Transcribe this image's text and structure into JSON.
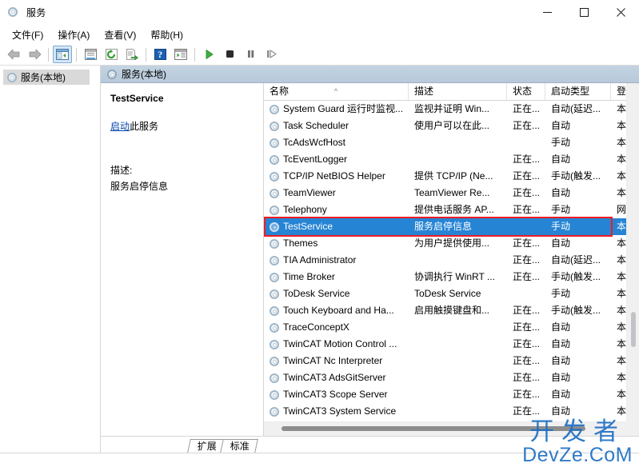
{
  "window": {
    "title": "服务",
    "icon": "services-gear-icon",
    "minimize_label": "—",
    "maximize_label": "□",
    "close_label": "✕"
  },
  "menubar": {
    "items": [
      {
        "label": "文件(F)",
        "name": "menu-file"
      },
      {
        "label": "操作(A)",
        "name": "menu-action"
      },
      {
        "label": "查看(V)",
        "name": "menu-view"
      },
      {
        "label": "帮助(H)",
        "name": "menu-help"
      }
    ]
  },
  "toolbar": {
    "buttons": [
      {
        "name": "back-button",
        "icon": "back-arrow-icon"
      },
      {
        "name": "forward-button",
        "icon": "forward-arrow-icon"
      },
      {
        "name": "show-hide-console-tree-button",
        "icon": "console-tree-icon",
        "active": true
      },
      {
        "name": "properties-button",
        "icon": "properties-window-icon"
      },
      {
        "name": "refresh-button",
        "icon": "refresh-icon"
      },
      {
        "name": "export-list-button",
        "icon": "export-list-icon"
      },
      {
        "name": "help-button",
        "icon": "help-question-icon"
      },
      {
        "name": "show-action-pane-button",
        "icon": "action-pane-icon"
      },
      {
        "name": "start-service-button",
        "icon": "play-icon"
      },
      {
        "name": "stop-service-button",
        "icon": "stop-square-icon"
      },
      {
        "name": "pause-service-button",
        "icon": "pause-bars-icon"
      },
      {
        "name": "restart-service-button",
        "icon": "restart-icon"
      }
    ]
  },
  "tree": {
    "root": {
      "label": "服务(本地)",
      "icon": "services-gear-icon",
      "selected": true
    }
  },
  "pane": {
    "header_title": "服务(本地)",
    "header_icon": "services-gear-icon"
  },
  "details": {
    "service_name": "TestService",
    "action_link": "启动",
    "action_suffix": "此服务",
    "description_label": "描述:",
    "description_text": "服务启停信息"
  },
  "list": {
    "columns": [
      {
        "label": "名称",
        "name": "column-name",
        "sort": "asc",
        "sort_glyph": "^"
      },
      {
        "label": "描述",
        "name": "column-description"
      },
      {
        "label": "状态",
        "name": "column-status"
      },
      {
        "label": "启动类型",
        "name": "column-startup-type"
      },
      {
        "label": "登录",
        "name": "column-log-on-as"
      }
    ],
    "rows": [
      {
        "name": "System Guard 运行时监视...",
        "description": "监视并证明 Win...",
        "status": "正在...",
        "startup": "自动(延迟...",
        "logon": "本地",
        "selected": false
      },
      {
        "name": "Task Scheduler",
        "description": "使用户可以在此...",
        "status": "正在...",
        "startup": "自动",
        "logon": "本地",
        "selected": false
      },
      {
        "name": "TcAdsWcfHost",
        "description": "",
        "status": "",
        "startup": "手动",
        "logon": "本地",
        "selected": false
      },
      {
        "name": "TcEventLogger",
        "description": "",
        "status": "正在...",
        "startup": "自动",
        "logon": "本地",
        "selected": false
      },
      {
        "name": "TCP/IP NetBIOS Helper",
        "description": "提供 TCP/IP (Ne...",
        "status": "正在...",
        "startup": "手动(触发...",
        "logon": "本地",
        "selected": false
      },
      {
        "name": "TeamViewer",
        "description": "TeamViewer Re...",
        "status": "正在...",
        "startup": "自动",
        "logon": "本地",
        "selected": false
      },
      {
        "name": "Telephony",
        "description": "提供电话服务 AP...",
        "status": "正在...",
        "startup": "手动",
        "logon": "网络",
        "selected": false
      },
      {
        "name": "TestService",
        "description": "服务启停信息",
        "status": "",
        "startup": "手动",
        "logon": "本地",
        "selected": true
      },
      {
        "name": "Themes",
        "description": "为用户提供使用...",
        "status": "正在...",
        "startup": "自动",
        "logon": "本地",
        "selected": false
      },
      {
        "name": "TIA Administrator",
        "description": "",
        "status": "正在...",
        "startup": "自动(延迟...",
        "logon": "本地",
        "selected": false
      },
      {
        "name": "Time Broker",
        "description": "协调执行 WinRT ...",
        "status": "正在...",
        "startup": "手动(触发...",
        "logon": "本地",
        "selected": false
      },
      {
        "name": "ToDesk Service",
        "description": "ToDesk Service",
        "status": "",
        "startup": "手动",
        "logon": "本地",
        "selected": false
      },
      {
        "name": "Touch Keyboard and Ha...",
        "description": "启用触摸键盘和...",
        "status": "正在...",
        "startup": "手动(触发...",
        "logon": "本地",
        "selected": false
      },
      {
        "name": "TraceConceptX",
        "description": "",
        "status": "正在...",
        "startup": "自动",
        "logon": "本地",
        "selected": false
      },
      {
        "name": "TwinCAT Motion Control ...",
        "description": "",
        "status": "正在...",
        "startup": "自动",
        "logon": "本地",
        "selected": false
      },
      {
        "name": "TwinCAT Nc Interpreter",
        "description": "",
        "status": "正在...",
        "startup": "自动",
        "logon": "本地",
        "selected": false
      },
      {
        "name": "TwinCAT3 AdsGitServer",
        "description": "",
        "status": "正在...",
        "startup": "自动",
        "logon": "本地",
        "selected": false
      },
      {
        "name": "TwinCAT3 Scope Server",
        "description": "",
        "status": "正在...",
        "startup": "自动",
        "logon": "本地",
        "selected": false
      },
      {
        "name": "TwinCAT3 System Service",
        "description": "",
        "status": "正在...",
        "startup": "自动",
        "logon": "本地",
        "selected": false
      }
    ]
  },
  "annotation": {
    "color": "#ee1c22",
    "target_row": "TestService"
  },
  "tabs": [
    {
      "label": "扩展",
      "name": "tab-extended",
      "active": false
    },
    {
      "label": "标准",
      "name": "tab-standard",
      "active": true
    }
  ],
  "watermark": {
    "line1": "开发者",
    "line2": "DevZe.CoM",
    "color": "#1f6fc4"
  }
}
